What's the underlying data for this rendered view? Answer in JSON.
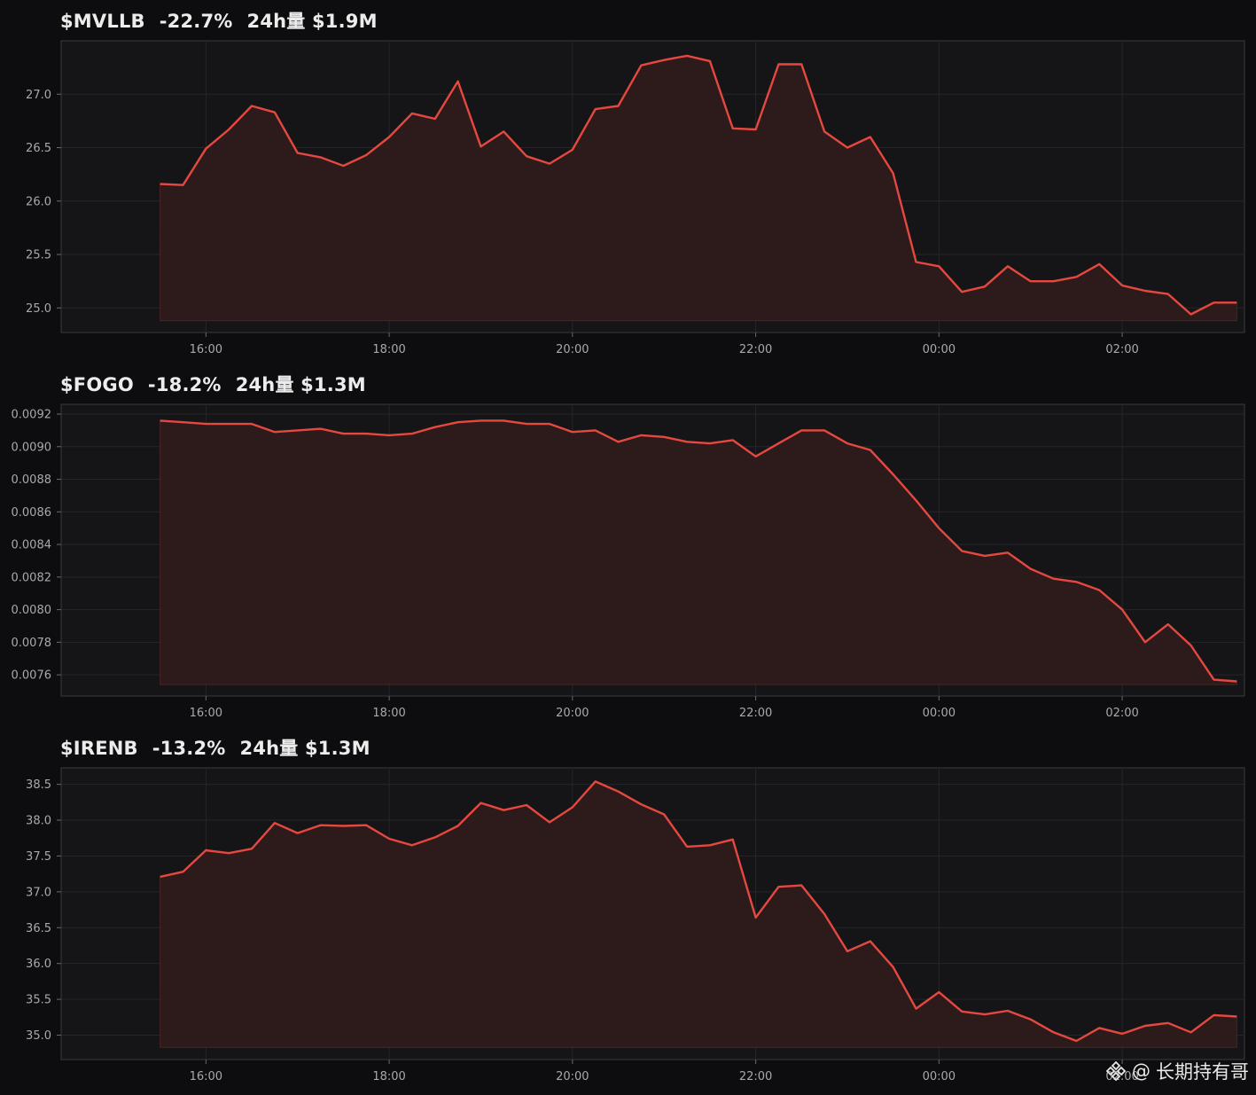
{
  "colors": {
    "line": "#e5483f",
    "fill": "#2e1b1c",
    "plot_bg": "#151518",
    "grid": "#26262a",
    "border": "#3a3a3e"
  },
  "watermark": {
    "at": "@",
    "name": "长期持有哥",
    "logo_icon": "binance-logo-icon"
  },
  "chart_data": [
    {
      "type": "area",
      "title": "",
      "header": {
        "ticker": "$MVLLB",
        "change": "-22.7%",
        "volume": "24h量 $1.9M"
      },
      "x_ticks": [
        "16:00",
        "18:00",
        "20:00",
        "22:00",
        "00:00",
        "02:00"
      ],
      "y_ticks": [
        "25.0",
        "25.5",
        "26.0",
        "26.5",
        "27.0"
      ],
      "ylim": [
        24.77,
        27.5
      ],
      "fill_base": 24.88,
      "x_hours": [
        15.5,
        15.75,
        16.0,
        16.25,
        16.5,
        16.75,
        17.0,
        17.25,
        17.5,
        17.75,
        18.0,
        18.25,
        18.5,
        18.75,
        19.0,
        19.25,
        19.5,
        19.75,
        20.0,
        20.25,
        20.5,
        20.75,
        21.0,
        21.25,
        21.5,
        21.75,
        22.0,
        22.25,
        22.5,
        22.75,
        23.0,
        23.25,
        23.5,
        23.75,
        24.0,
        24.25,
        24.5,
        24.75,
        25.0,
        25.25,
        25.5,
        25.75,
        26.0,
        26.25,
        26.5,
        26.75,
        27.0,
        27.25
      ],
      "values": [
        26.16,
        26.15,
        26.49,
        26.67,
        26.89,
        26.83,
        26.45,
        26.41,
        26.33,
        26.43,
        26.6,
        26.82,
        26.77,
        27.12,
        26.51,
        26.65,
        26.42,
        26.35,
        26.48,
        26.86,
        26.89,
        27.27,
        27.32,
        27.36,
        27.31,
        26.68,
        26.67,
        27.28,
        27.28,
        26.65,
        26.5,
        26.6,
        26.26,
        25.43,
        25.39,
        25.15,
        25.2,
        25.39,
        25.25,
        25.25,
        25.29,
        25.41,
        25.21,
        25.16,
        25.13,
        24.94,
        25.05,
        25.05
      ]
    },
    {
      "type": "area",
      "title": "",
      "header": {
        "ticker": "$FOGO",
        "change": "-18.2%",
        "volume": "24h量 $1.3M"
      },
      "x_ticks": [
        "16:00",
        "18:00",
        "20:00",
        "22:00",
        "00:00",
        "02:00"
      ],
      "y_ticks": [
        "0.0076",
        "0.0078",
        "0.0080",
        "0.0082",
        "0.0084",
        "0.0086",
        "0.0088",
        "0.0090",
        "0.0092"
      ],
      "ylim": [
        0.00747,
        0.00926
      ],
      "fill_base": 0.00754,
      "x_hours": [
        15.5,
        15.75,
        16.0,
        16.25,
        16.5,
        16.75,
        17.0,
        17.25,
        17.5,
        17.75,
        18.0,
        18.25,
        18.5,
        18.75,
        19.0,
        19.25,
        19.5,
        19.75,
        20.0,
        20.25,
        20.5,
        20.75,
        21.0,
        21.25,
        21.5,
        21.75,
        22.0,
        22.25,
        22.5,
        22.75,
        23.0,
        23.25,
        23.5,
        23.75,
        24.0,
        24.25,
        24.5,
        24.75,
        25.0,
        25.25,
        25.5,
        25.75,
        26.0,
        26.25,
        26.5,
        26.75,
        27.0,
        27.25
      ],
      "values": [
        0.00916,
        0.00915,
        0.00914,
        0.00914,
        0.00914,
        0.00909,
        0.0091,
        0.00911,
        0.00908,
        0.00908,
        0.00907,
        0.00908,
        0.00912,
        0.00915,
        0.00916,
        0.00916,
        0.00914,
        0.00914,
        0.00909,
        0.0091,
        0.00903,
        0.00907,
        0.00906,
        0.00903,
        0.00902,
        0.00904,
        0.00894,
        0.00902,
        0.0091,
        0.0091,
        0.00902,
        0.00898,
        0.00883,
        0.00867,
        0.0085,
        0.00836,
        0.00833,
        0.00835,
        0.00825,
        0.00819,
        0.00817,
        0.00812,
        0.008,
        0.0078,
        0.00791,
        0.00778,
        0.00757,
        0.00756
      ]
    },
    {
      "type": "area",
      "title": "",
      "header": {
        "ticker": "$IRENB",
        "change": "-13.2%",
        "volume": "24h量 $1.3M"
      },
      "x_ticks": [
        "16:00",
        "18:00",
        "20:00",
        "22:00",
        "00:00",
        "02:00"
      ],
      "y_ticks": [
        "35.0",
        "35.5",
        "36.0",
        "36.5",
        "37.0",
        "37.5",
        "38.0",
        "38.5"
      ],
      "ylim": [
        34.66,
        38.73
      ],
      "fill_base": 34.83,
      "x_hours": [
        15.5,
        15.75,
        16.0,
        16.25,
        16.5,
        16.75,
        17.0,
        17.25,
        17.5,
        17.75,
        18.0,
        18.25,
        18.5,
        18.75,
        19.0,
        19.25,
        19.5,
        19.75,
        20.0,
        20.25,
        20.5,
        20.75,
        21.0,
        21.25,
        21.5,
        21.75,
        22.0,
        22.25,
        22.5,
        22.75,
        23.0,
        23.25,
        23.5,
        23.75,
        24.0,
        24.25,
        24.5,
        24.75,
        25.0,
        25.25,
        25.5,
        25.75,
        26.0,
        26.25,
        26.5,
        26.75,
        27.0,
        27.25
      ],
      "values": [
        37.21,
        37.28,
        37.58,
        37.54,
        37.6,
        37.96,
        37.82,
        37.93,
        37.92,
        37.93,
        37.74,
        37.65,
        37.76,
        37.92,
        38.24,
        38.14,
        38.21,
        37.97,
        38.18,
        38.54,
        38.4,
        38.22,
        38.08,
        37.63,
        37.65,
        37.73,
        36.64,
        37.07,
        37.09,
        36.69,
        36.17,
        36.31,
        35.95,
        35.37,
        35.6,
        35.33,
        35.29,
        35.34,
        35.22,
        35.04,
        34.92,
        35.1,
        35.02,
        35.13,
        35.17,
        35.04,
        35.28,
        35.26
      ]
    }
  ]
}
